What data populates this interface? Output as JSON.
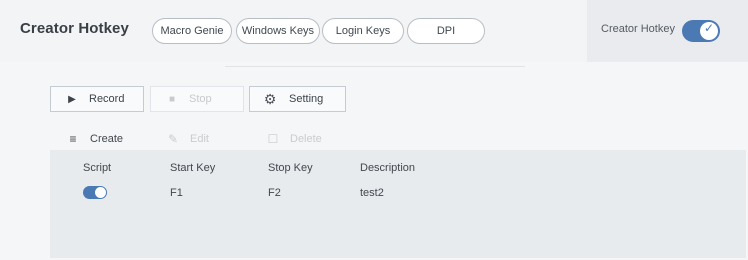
{
  "header": {
    "title": "Creator Hotkey",
    "tabs": [
      {
        "label": "Macro Genie"
      },
      {
        "label": "Windows Keys"
      },
      {
        "label": "Login Keys"
      },
      {
        "label": "DPI"
      }
    ],
    "creator_toggle_label": "Creator Hotkey",
    "creator_toggle_on": true
  },
  "toolbar": {
    "record_label": "Record",
    "stop_label": "Stop",
    "setting_label": "Setting",
    "record_icon": "▶",
    "stop_icon": "■",
    "setting_icon": "⚙"
  },
  "actions": {
    "create_label": "Create",
    "edit_label": "Edit",
    "delete_label": "Delete",
    "create_icon": "≡",
    "edit_icon": "✎",
    "delete_icon": "☐"
  },
  "table": {
    "columns": [
      "Script",
      "Start Key",
      "Stop Key",
      "Description"
    ],
    "rows": [
      {
        "script_enabled": true,
        "start_key": "F1",
        "stop_key": "F2",
        "description": "test2"
      }
    ]
  },
  "colors": {
    "accent": "#4b79b4",
    "panel": "#e8ebee",
    "header": "#f3f4f5"
  }
}
